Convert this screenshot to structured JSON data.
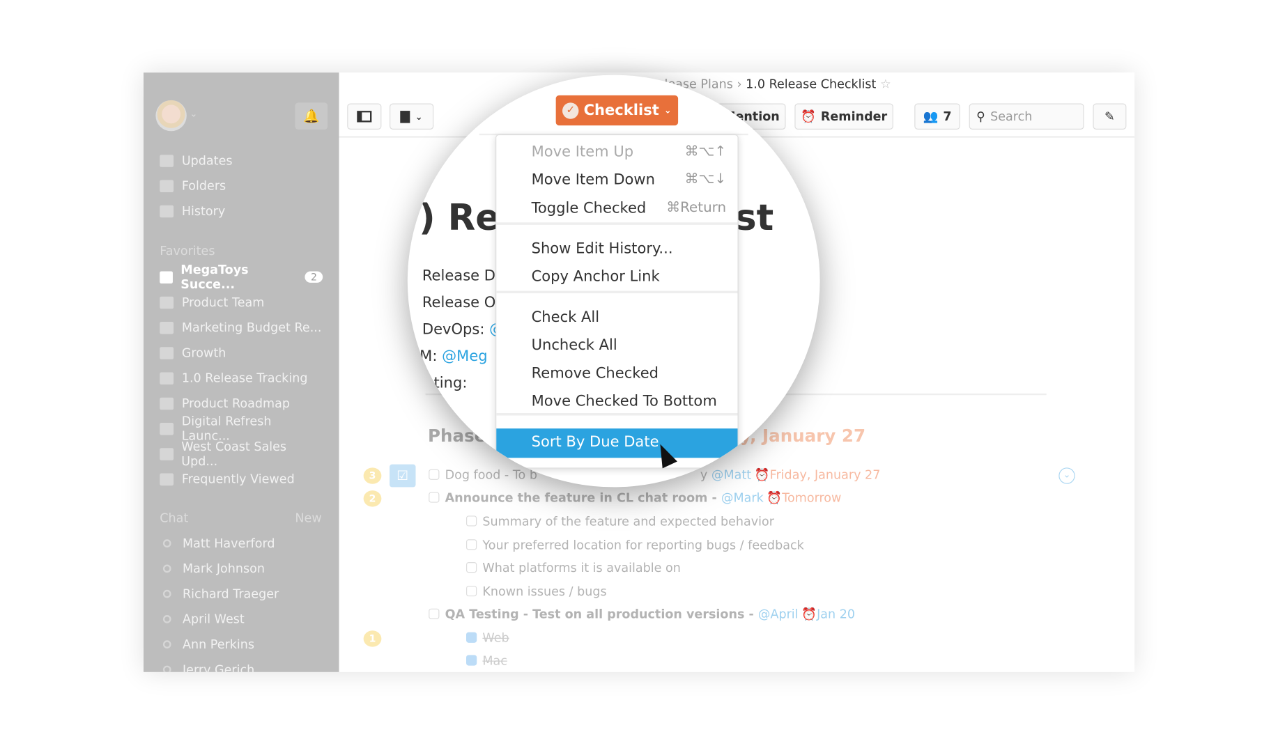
{
  "sidebar": {
    "nav": [
      {
        "label": "Updates",
        "icon": "updates-icon"
      },
      {
        "label": "Folders",
        "icon": "folders-icon"
      },
      {
        "label": "History",
        "icon": "history-icon"
      }
    ],
    "favorites_title": "Favorites",
    "favorites": [
      {
        "label": "MegaToys Succe...",
        "badge": "2",
        "active": true
      },
      {
        "label": "Product Team"
      },
      {
        "label": "Marketing Budget Re..."
      },
      {
        "label": "Growth"
      },
      {
        "label": "1.0 Release Tracking"
      },
      {
        "label": "Product Roadmap"
      },
      {
        "label": "Digital Refresh Launc..."
      },
      {
        "label": "West Coast Sales Upd..."
      },
      {
        "label": "Frequently Viewed"
      }
    ],
    "chat_title": "Chat",
    "chat_new": "New",
    "chats": [
      "Matt Haverford",
      "Mark Johnson",
      "Richard Traeger",
      "April West",
      "Ann Perkins",
      "Jerry Gerich"
    ]
  },
  "header": {
    "breadcrumb_parent": "elease Plans",
    "breadcrumb_sep": "›",
    "breadcrumb_current": "1.0 Release Checklist"
  },
  "toolbar": {
    "checklist": "Checklist",
    "mention": "Mention",
    "reminder": "Reminder",
    "members": "7",
    "search_placeholder": "Search"
  },
  "menu": {
    "items": [
      {
        "label": "Move Item Up",
        "shortcut": "⌘⌥↑",
        "disabled": true
      },
      {
        "label": "Move Item Down",
        "shortcut": "⌘⌥↓"
      },
      {
        "label": "Toggle Checked",
        "shortcut": "⌘Return"
      },
      {
        "label": "Show Edit History..."
      },
      {
        "label": "Copy Anchor Link"
      },
      {
        "label": "Check All"
      },
      {
        "label": "Uncheck All"
      },
      {
        "label": "Remove Checked"
      },
      {
        "label": "Move Checked To Bottom"
      },
      {
        "label": "Sort By Due Date",
        "highlighted": true
      }
    ]
  },
  "doc": {
    "title_left": ") Rel",
    "title_right": "st",
    "meta": [
      "Release Da",
      "Release Ow",
      "DevOps: ",
      "PM: ",
      "rketing:"
    ],
    "meta_mentions": [
      "@",
      "@Meg"
    ],
    "phase": "Phase",
    "phase_date": "y, January 27",
    "rows": [
      {
        "text": "Dog food - To b",
        "tail": "y",
        "mention": "@Matt",
        "date": "Friday, January 27",
        "badge": "3"
      },
      {
        "text": "Announce the feature in CL chat room - ",
        "mention": "@Mark",
        "date": "Tomorrow",
        "badge": "2"
      },
      {
        "text": "Summary of the feature and expected behavior"
      },
      {
        "text": "Your preferred location for reporting bugs / feedback"
      },
      {
        "text": "What platforms it is available on"
      },
      {
        "text": "Known issues / bugs"
      },
      {
        "text": "QA Testing - Test on all production versions - ",
        "mention": "@April",
        "date": "Jan 20"
      },
      {
        "text": "Web",
        "checked": true,
        "badge": "1"
      },
      {
        "text": "Mac",
        "checked": true
      }
    ]
  },
  "colors": {
    "accent": "#e8703a",
    "highlight": "#2ba3e0",
    "mention": "#2ba3e0",
    "sidebar": "#bdbdbd"
  }
}
